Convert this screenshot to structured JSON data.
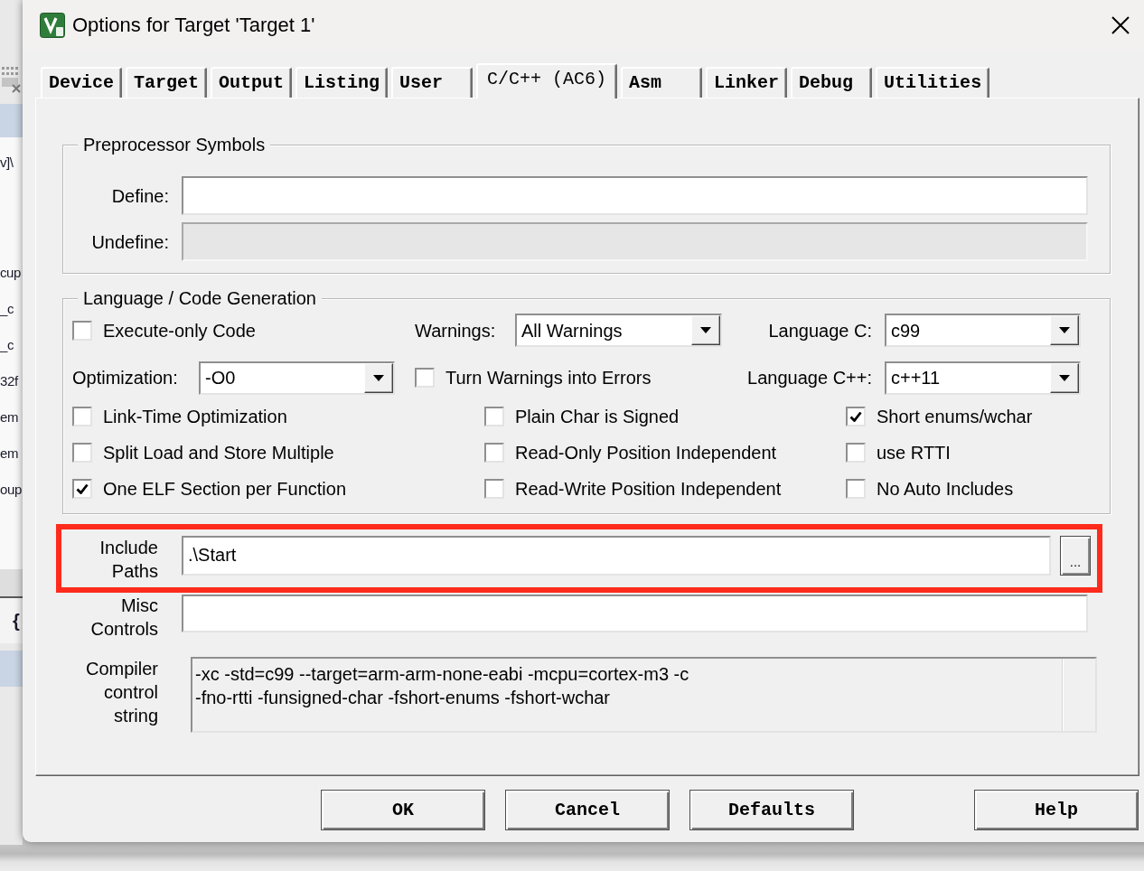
{
  "background_window": {
    "list_items": [
      "v]\\",
      "cup",
      "_c",
      "_c",
      "32f",
      "em",
      "em",
      "oup"
    ],
    "code_text": "{"
  },
  "window": {
    "title": "Options for Target 'Target 1'"
  },
  "tabs": [
    {
      "label": "Device",
      "selected": false
    },
    {
      "label": "Target",
      "selected": false
    },
    {
      "label": "Output",
      "selected": false
    },
    {
      "label": "Listing",
      "selected": false
    },
    {
      "label": "User",
      "selected": false
    },
    {
      "label": "C/C++ (AC6)",
      "selected": true
    },
    {
      "label": "Asm",
      "selected": false
    },
    {
      "label": "Linker",
      "selected": false
    },
    {
      "label": "Debug",
      "selected": false
    },
    {
      "label": "Utilities",
      "selected": false
    }
  ],
  "preprocessor_symbols": {
    "title": "Preprocessor Symbols",
    "fields": [
      {
        "label": "Define:",
        "disabled": false
      },
      {
        "label": "Undefine:",
        "disabled": true
      }
    ]
  },
  "language_code_generation": {
    "title": "Language / Code Generation",
    "rows": [
      {
        "items": [
          {
            "kind": "checkbox",
            "label": "Execute-only Code",
            "checked": false
          },
          {
            "kind": "dropdown",
            "label": "Warnings:",
            "value": "All Warnings"
          },
          {
            "kind": "dropdown",
            "label": "Language C:",
            "value": "c99"
          }
        ]
      },
      {
        "items": [
          {
            "kind": "dropdown",
            "label": "Optimization:",
            "value": "-O0"
          },
          {
            "kind": "checkbox",
            "label": "Turn Warnings into Errors",
            "checked": false
          },
          {
            "kind": "dropdown",
            "label": "Language C++:",
            "value": "c++11"
          }
        ]
      },
      {
        "items": [
          {
            "kind": "checkbox",
            "label": "Link-Time Optimization",
            "checked": false
          },
          {
            "kind": "checkbox",
            "label": "Plain Char is Signed",
            "checked": false
          },
          {
            "kind": "checkbox",
            "label": "Short enums/wchar",
            "checked": true
          }
        ]
      },
      {
        "items": [
          {
            "kind": "checkbox",
            "label": "Split Load and Store Multiple",
            "checked": false
          },
          {
            "kind": "checkbox",
            "label": "Read-Only Position Independent",
            "checked": false
          },
          {
            "kind": "checkbox",
            "label": "use RTTI",
            "checked": false
          }
        ]
      },
      {
        "items": [
          {
            "kind": "checkbox",
            "label": "One ELF Section per Function",
            "checked": true
          },
          {
            "kind": "checkbox",
            "label": "Read-Write Position Independent",
            "checked": false
          },
          {
            "kind": "checkbox",
            "label": "No Auto Includes",
            "checked": false
          }
        ]
      }
    ]
  },
  "paths": [
    {
      "kind": "input",
      "label": "Include Paths",
      "value": ".\\Start",
      "highlighted": true,
      "browse_button": "..."
    },
    {
      "kind": "input",
      "label": "Misc Controls",
      "highlighted": false
    },
    {
      "kind": "readonly",
      "label": "Compiler control string",
      "value": "-xc -std=c99 --target=arm-arm-none-eabi -mcpu=cortex-m3 -c\n-fno-rtti -funsigned-char -fshort-enums -fshort-wchar"
    }
  ],
  "buttons": [
    "OK",
    "Cancel",
    "Defaults",
    "Help"
  ]
}
